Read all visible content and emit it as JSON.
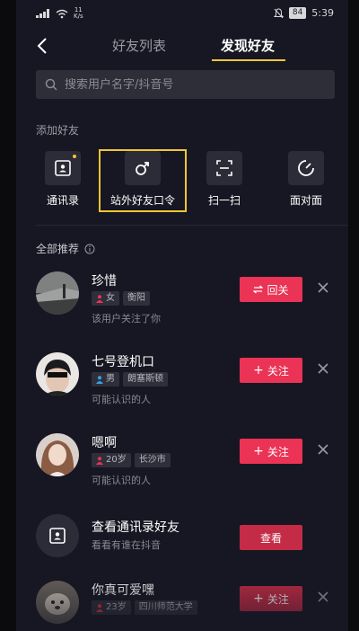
{
  "status_bar": {
    "network_speed_value": "11",
    "network_speed_unit": "K/s",
    "battery": "84",
    "time": "5:39"
  },
  "nav": {
    "tabs": [
      {
        "label": "好友列表"
      },
      {
        "label": "发现好友"
      }
    ],
    "active_tab": "发现好友"
  },
  "search": {
    "placeholder": "搜索用户名字/抖音号"
  },
  "add_friends": {
    "title": "添加好友",
    "items": [
      {
        "label": "通讯录",
        "icon": "contact-card-icon"
      },
      {
        "label": "站外好友口令",
        "icon": "male-symbol-icon"
      },
      {
        "label": "扫一扫",
        "icon": "scan-icon"
      },
      {
        "label": "面对面",
        "icon": "gauge-icon"
      }
    ]
  },
  "recommend": {
    "title": "全部推荐",
    "rows": [
      {
        "name": "珍惜",
        "tags": [
          "女",
          "衡阳"
        ],
        "desc": "该用户关注了你",
        "button": "回关"
      },
      {
        "name": "七号登机口",
        "tags": [
          "男",
          "朗塞斯顿"
        ],
        "desc": "可能认识的人",
        "button": "关注"
      },
      {
        "name": "嗯啊",
        "tags": [
          "20岁",
          "长沙市"
        ],
        "desc": "可能认识的人",
        "button": "关注"
      },
      {
        "name": "查看通讯录好友",
        "tags": [],
        "desc": "看看有谁在抖音",
        "button": "查看"
      },
      {
        "name": "你真可爱嘿",
        "tags": [
          "23岁",
          "四川师范大学"
        ],
        "desc": "",
        "button": "关注"
      }
    ]
  },
  "colors": {
    "accent_yellow": "#f4c633",
    "button_red": "#ea3355",
    "background": "#161722"
  }
}
